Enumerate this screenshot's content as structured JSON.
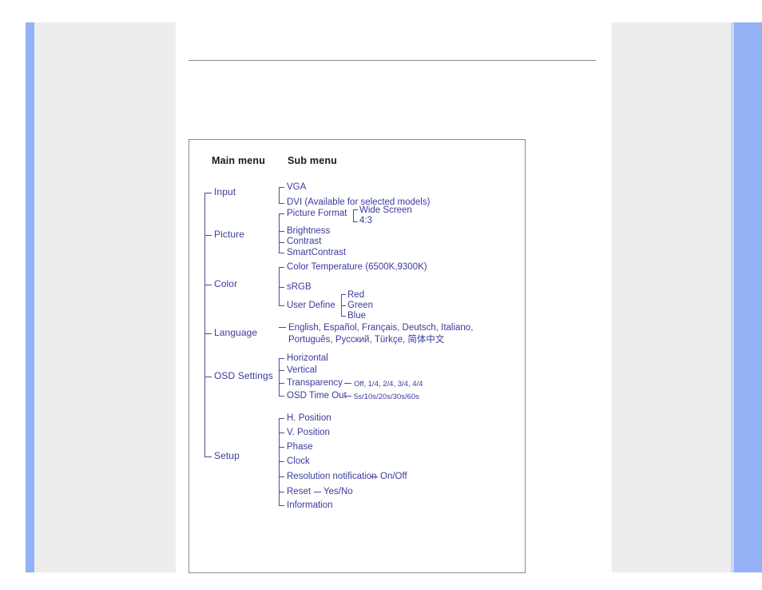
{
  "page": {
    "colors": {
      "rail_blue": "#93b2f5",
      "panel_gray": "#ededed",
      "menu_text": "#3b3b9e",
      "header_text": "#1a1a1a",
      "frame_border": "#8c8c8c",
      "rule": "#8a8a8a"
    }
  },
  "headers": {
    "main_menu": "Main menu",
    "sub_menu": "Sub menu"
  },
  "menu": {
    "items": [
      {
        "label": "Input",
        "children": [
          {
            "label": "VGA"
          },
          {
            "label": "DVI (Available for selected models)"
          }
        ]
      },
      {
        "label": "Picture",
        "children": [
          {
            "label": "Picture Format",
            "children": [
              {
                "label": "Wide Screen"
              },
              {
                "label": "4:3"
              }
            ]
          },
          {
            "label": "Brightness"
          },
          {
            "label": "Contrast"
          },
          {
            "label": "SmartContrast"
          }
        ]
      },
      {
        "label": "Color",
        "children": [
          {
            "label": "Color Temperature",
            "note": "(6500K,9300K)"
          },
          {
            "label": "sRGB"
          },
          {
            "label": "User Define",
            "children": [
              {
                "label": "Red"
              },
              {
                "label": "Green"
              },
              {
                "label": "Blue"
              }
            ]
          }
        ]
      },
      {
        "label": "Language",
        "children": [
          {
            "label": "English, Español, Français, Deutsch, Italiano, Português, Русский, Türkçe, 简体中文"
          }
        ]
      },
      {
        "label": "OSD Settings",
        "children": [
          {
            "label": "Horizontal"
          },
          {
            "label": "Vertical"
          },
          {
            "label": "Transparency",
            "values": "Off, 1/4, 2/4, 3/4, 4/4"
          },
          {
            "label": "OSD Time Out",
            "values": "5s/10s/20s/30s/60s"
          }
        ]
      },
      {
        "label": "Setup",
        "children": [
          {
            "label": "H. Position"
          },
          {
            "label": "V. Position"
          },
          {
            "label": "Phase"
          },
          {
            "label": "Clock"
          },
          {
            "label": "Resolution notification",
            "values": "On/Off"
          },
          {
            "label": "Reset",
            "values": "Yes/No"
          },
          {
            "label": "Information"
          }
        ]
      }
    ]
  },
  "labels": {
    "input": "Input",
    "picture": "Picture",
    "color": "Color",
    "language": "Language",
    "osd_settings": "OSD Settings",
    "setup": "Setup",
    "vga": "VGA",
    "dvi": "DVI (Available for selected models)",
    "picture_format": "Picture Format",
    "wide_screen": "Wide Screen",
    "four_three": "4:3",
    "brightness": "Brightness",
    "contrast": "Contrast",
    "smart_contrast": "SmartContrast",
    "color_temperature": "Color Temperature",
    "color_temperature_note": "(6500K,9300K)",
    "srgb": "sRGB",
    "user_define": "User Define",
    "red": "Red",
    "green": "Green",
    "blue": "Blue",
    "languages": "English, Español, Français, Deutsch, Italiano, Português, Русский, Türkçe, 简体中文",
    "horizontal": "Horizontal",
    "vertical": "Vertical",
    "transparency": "Transparency",
    "transparency_values": "Off, 1/4, 2/4, 3/4, 4/4",
    "osd_time_out": "OSD Time Out",
    "osd_time_out_values": "5s/10s/20s/30s/60s",
    "h_position": "H. Position",
    "v_position": "V. Position",
    "phase": "Phase",
    "clock": "Clock",
    "resolution_notification": "Resolution notification",
    "resolution_notification_values": "On/Off",
    "reset": "Reset",
    "reset_values": "Yes/No",
    "information": "Information"
  }
}
